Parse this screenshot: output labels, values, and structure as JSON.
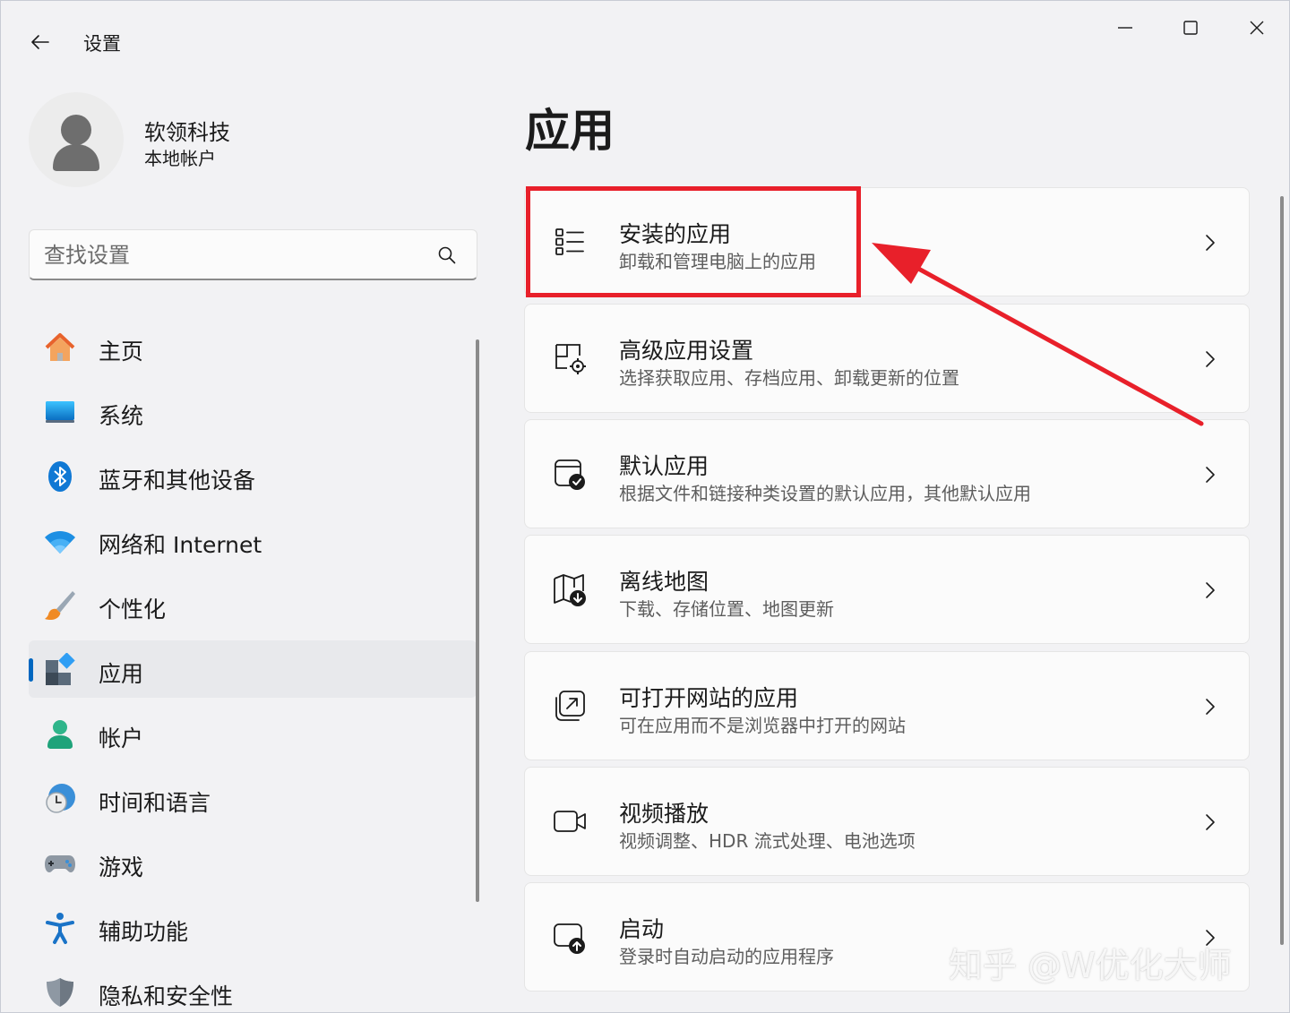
{
  "window": {
    "title": "设置"
  },
  "profile": {
    "name": "软领科技",
    "account_type": "本地帐户"
  },
  "search": {
    "placeholder": "查找设置",
    "value": ""
  },
  "nav": {
    "items": [
      {
        "label": "主页",
        "icon": "home-icon"
      },
      {
        "label": "系统",
        "icon": "monitor-icon"
      },
      {
        "label": "蓝牙和其他设备",
        "icon": "bluetooth-icon"
      },
      {
        "label": "网络和 Internet",
        "icon": "wifi-icon"
      },
      {
        "label": "个性化",
        "icon": "brush-icon"
      },
      {
        "label": "应用",
        "icon": "apps-icon",
        "selected": true
      },
      {
        "label": "帐户",
        "icon": "person-icon"
      },
      {
        "label": "时间和语言",
        "icon": "clock-globe-icon"
      },
      {
        "label": "游戏",
        "icon": "gamepad-icon"
      },
      {
        "label": "辅助功能",
        "icon": "accessibility-icon"
      },
      {
        "label": "隐私和安全性",
        "icon": "shield-icon"
      }
    ]
  },
  "main": {
    "title": "应用",
    "cards": [
      {
        "title": "安装的应用",
        "subtitle": "卸载和管理电脑上的应用",
        "icon": "list-icon"
      },
      {
        "title": "高级应用设置",
        "subtitle": "选择获取应用、存档应用、卸载更新的位置",
        "icon": "app-settings-icon"
      },
      {
        "title": "默认应用",
        "subtitle": "根据文件和链接种类设置的默认应用，其他默认应用",
        "icon": "default-app-icon"
      },
      {
        "title": "离线地图",
        "subtitle": "下载、存储位置、地图更新",
        "icon": "map-download-icon"
      },
      {
        "title": "可打开网站的应用",
        "subtitle": "可在应用而不是浏览器中打开的网站",
        "icon": "open-external-icon"
      },
      {
        "title": "视频播放",
        "subtitle": "视频调整、HDR 流式处理、电池选项",
        "icon": "video-icon"
      },
      {
        "title": "启动",
        "subtitle": "登录时自动启动的应用程序",
        "icon": "startup-icon"
      }
    ]
  },
  "annotation": {
    "color": "#e8202a",
    "watermark": "知乎 @W优化大师"
  },
  "colors": {
    "accent": "#0067c0",
    "background": "#f2f2f4",
    "card": "#fbfbfb"
  }
}
